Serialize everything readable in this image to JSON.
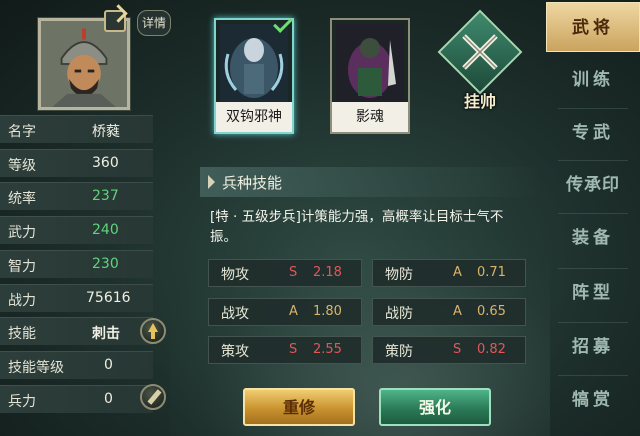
{
  "hero": {
    "detail_label": "详情",
    "stats": [
      {
        "label": "名字",
        "value": "桥蕤",
        "color": "white"
      },
      {
        "label": "等级",
        "value": "360",
        "color": "white"
      },
      {
        "label": "统率",
        "value": "237",
        "color": "green"
      },
      {
        "label": "武力",
        "value": "240",
        "color": "green"
      },
      {
        "label": "智力",
        "value": "230",
        "color": "green"
      },
      {
        "label": "战力",
        "value": "75616",
        "color": "white"
      },
      {
        "label": "技能",
        "value": "刺击",
        "color": "white"
      },
      {
        "label": "技能等级",
        "value": "0",
        "color": "white"
      },
      {
        "label": "兵力",
        "value": "0",
        "color": "white"
      }
    ]
  },
  "units": [
    {
      "name": "双钩邪神",
      "selected": true
    },
    {
      "name": "影魂",
      "selected": false
    }
  ],
  "gua_label": "挂帅",
  "skill": {
    "header": "兵种技能",
    "description": "[特 · 五级步兵]计策能力强，高概率让目标士气不振。"
  },
  "rates": [
    {
      "label": "物攻",
      "grade": "S",
      "value": "2.18"
    },
    {
      "label": "物防",
      "grade": "A",
      "value": "0.71"
    },
    {
      "label": "战攻",
      "grade": "A",
      "value": "1.80"
    },
    {
      "label": "战防",
      "grade": "A",
      "value": "0.65"
    },
    {
      "label": "策攻",
      "grade": "S",
      "value": "2.55"
    },
    {
      "label": "策防",
      "grade": "S",
      "value": "0.82"
    }
  ],
  "buttons": {
    "reset": "重修",
    "enhance": "强化"
  },
  "tabs": [
    "武将",
    "训练",
    "专武",
    "传承印",
    "装备",
    "阵型",
    "招募",
    "犒赏"
  ],
  "colors": {
    "grade_S": "#e0575a",
    "grade_A": "#d9b36c",
    "stat_green": "#5fd47a",
    "tab_active": "#caa35e"
  }
}
